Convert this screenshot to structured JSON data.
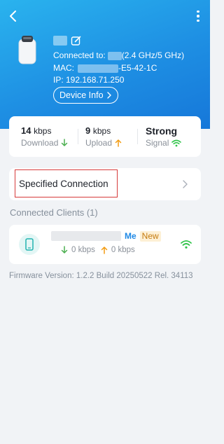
{
  "device": {
    "connected_prefix": "Connected to:",
    "connected_suffix": "(2.4 GHz/5 GHz)",
    "mac_prefix": "MAC:",
    "mac_suffix": "-E5-42-1C",
    "ip": "IP: 192.168.71.250",
    "device_info_label": "Device Info"
  },
  "stats": {
    "download_value": "14",
    "download_unit": "kbps",
    "download_label": "Download",
    "upload_value": "9",
    "upload_unit": "kbps",
    "upload_label": "Upload",
    "signal_value": "Strong",
    "signal_label": "Signal"
  },
  "specified_connection": {
    "label": "Specified Connection"
  },
  "clients": {
    "section_title": "Connected Clients (1)",
    "items": [
      {
        "me_tag": "Me",
        "new_tag": "New",
        "download": "0 kbps",
        "upload": "0 kbps"
      }
    ]
  },
  "firmware": "Firmware Version: 1.2.2 Build 20250522 Rel. 34113",
  "colors": {
    "header_gradient_start": "#2ab3ee",
    "header_gradient_end": "#1677d9",
    "download_arrow": "#4caf50",
    "upload_arrow": "#f39c12",
    "wifi_green": "#31c44a",
    "highlight_border": "#d63b3b"
  },
  "icons": {
    "back": "chevron-left-icon",
    "more": "more-vertical-icon",
    "edit": "edit-icon",
    "chevron_right": "chevron-right-icon",
    "download": "arrow-down-icon",
    "upload": "arrow-up-icon",
    "signal": "wifi-icon",
    "client": "phone-icon"
  }
}
